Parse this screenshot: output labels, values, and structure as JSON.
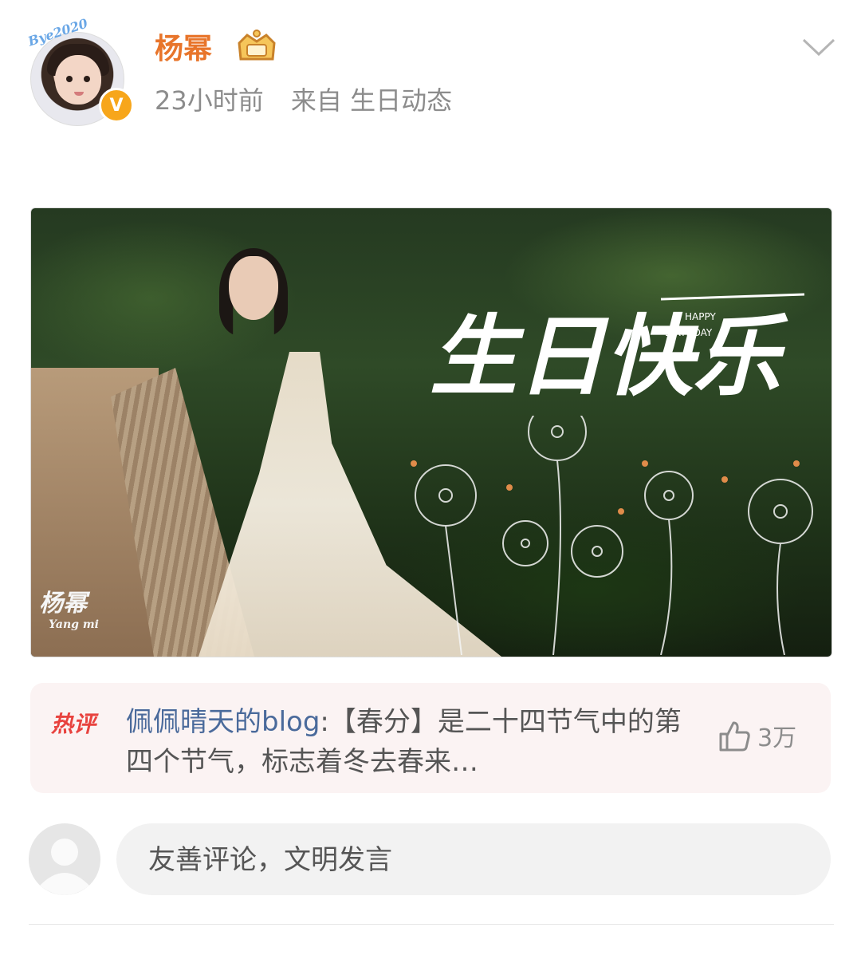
{
  "post": {
    "username": "杨幂",
    "time": "23小时前",
    "source": "来自 生日动态",
    "avatar_badge_text": "Bye2020"
  },
  "image": {
    "title_text": "生日快乐",
    "subtitle_line1": "HAPPY",
    "subtitle_line2": "BIRTHDAY",
    "signature": "杨幂",
    "signature_sub": "Yang mi"
  },
  "hot_comment": {
    "label": "热评",
    "user": "佩佩晴天的blog",
    "text": ":【春分】是二十四节气中的第四个节气，标志着冬去春来…",
    "likes": "3万"
  },
  "comment_input": {
    "placeholder": "友善评论，文明发言"
  },
  "colors": {
    "username": "#e8752b",
    "hot_label": "#e8423e",
    "link_user": "#4a6a9b"
  }
}
